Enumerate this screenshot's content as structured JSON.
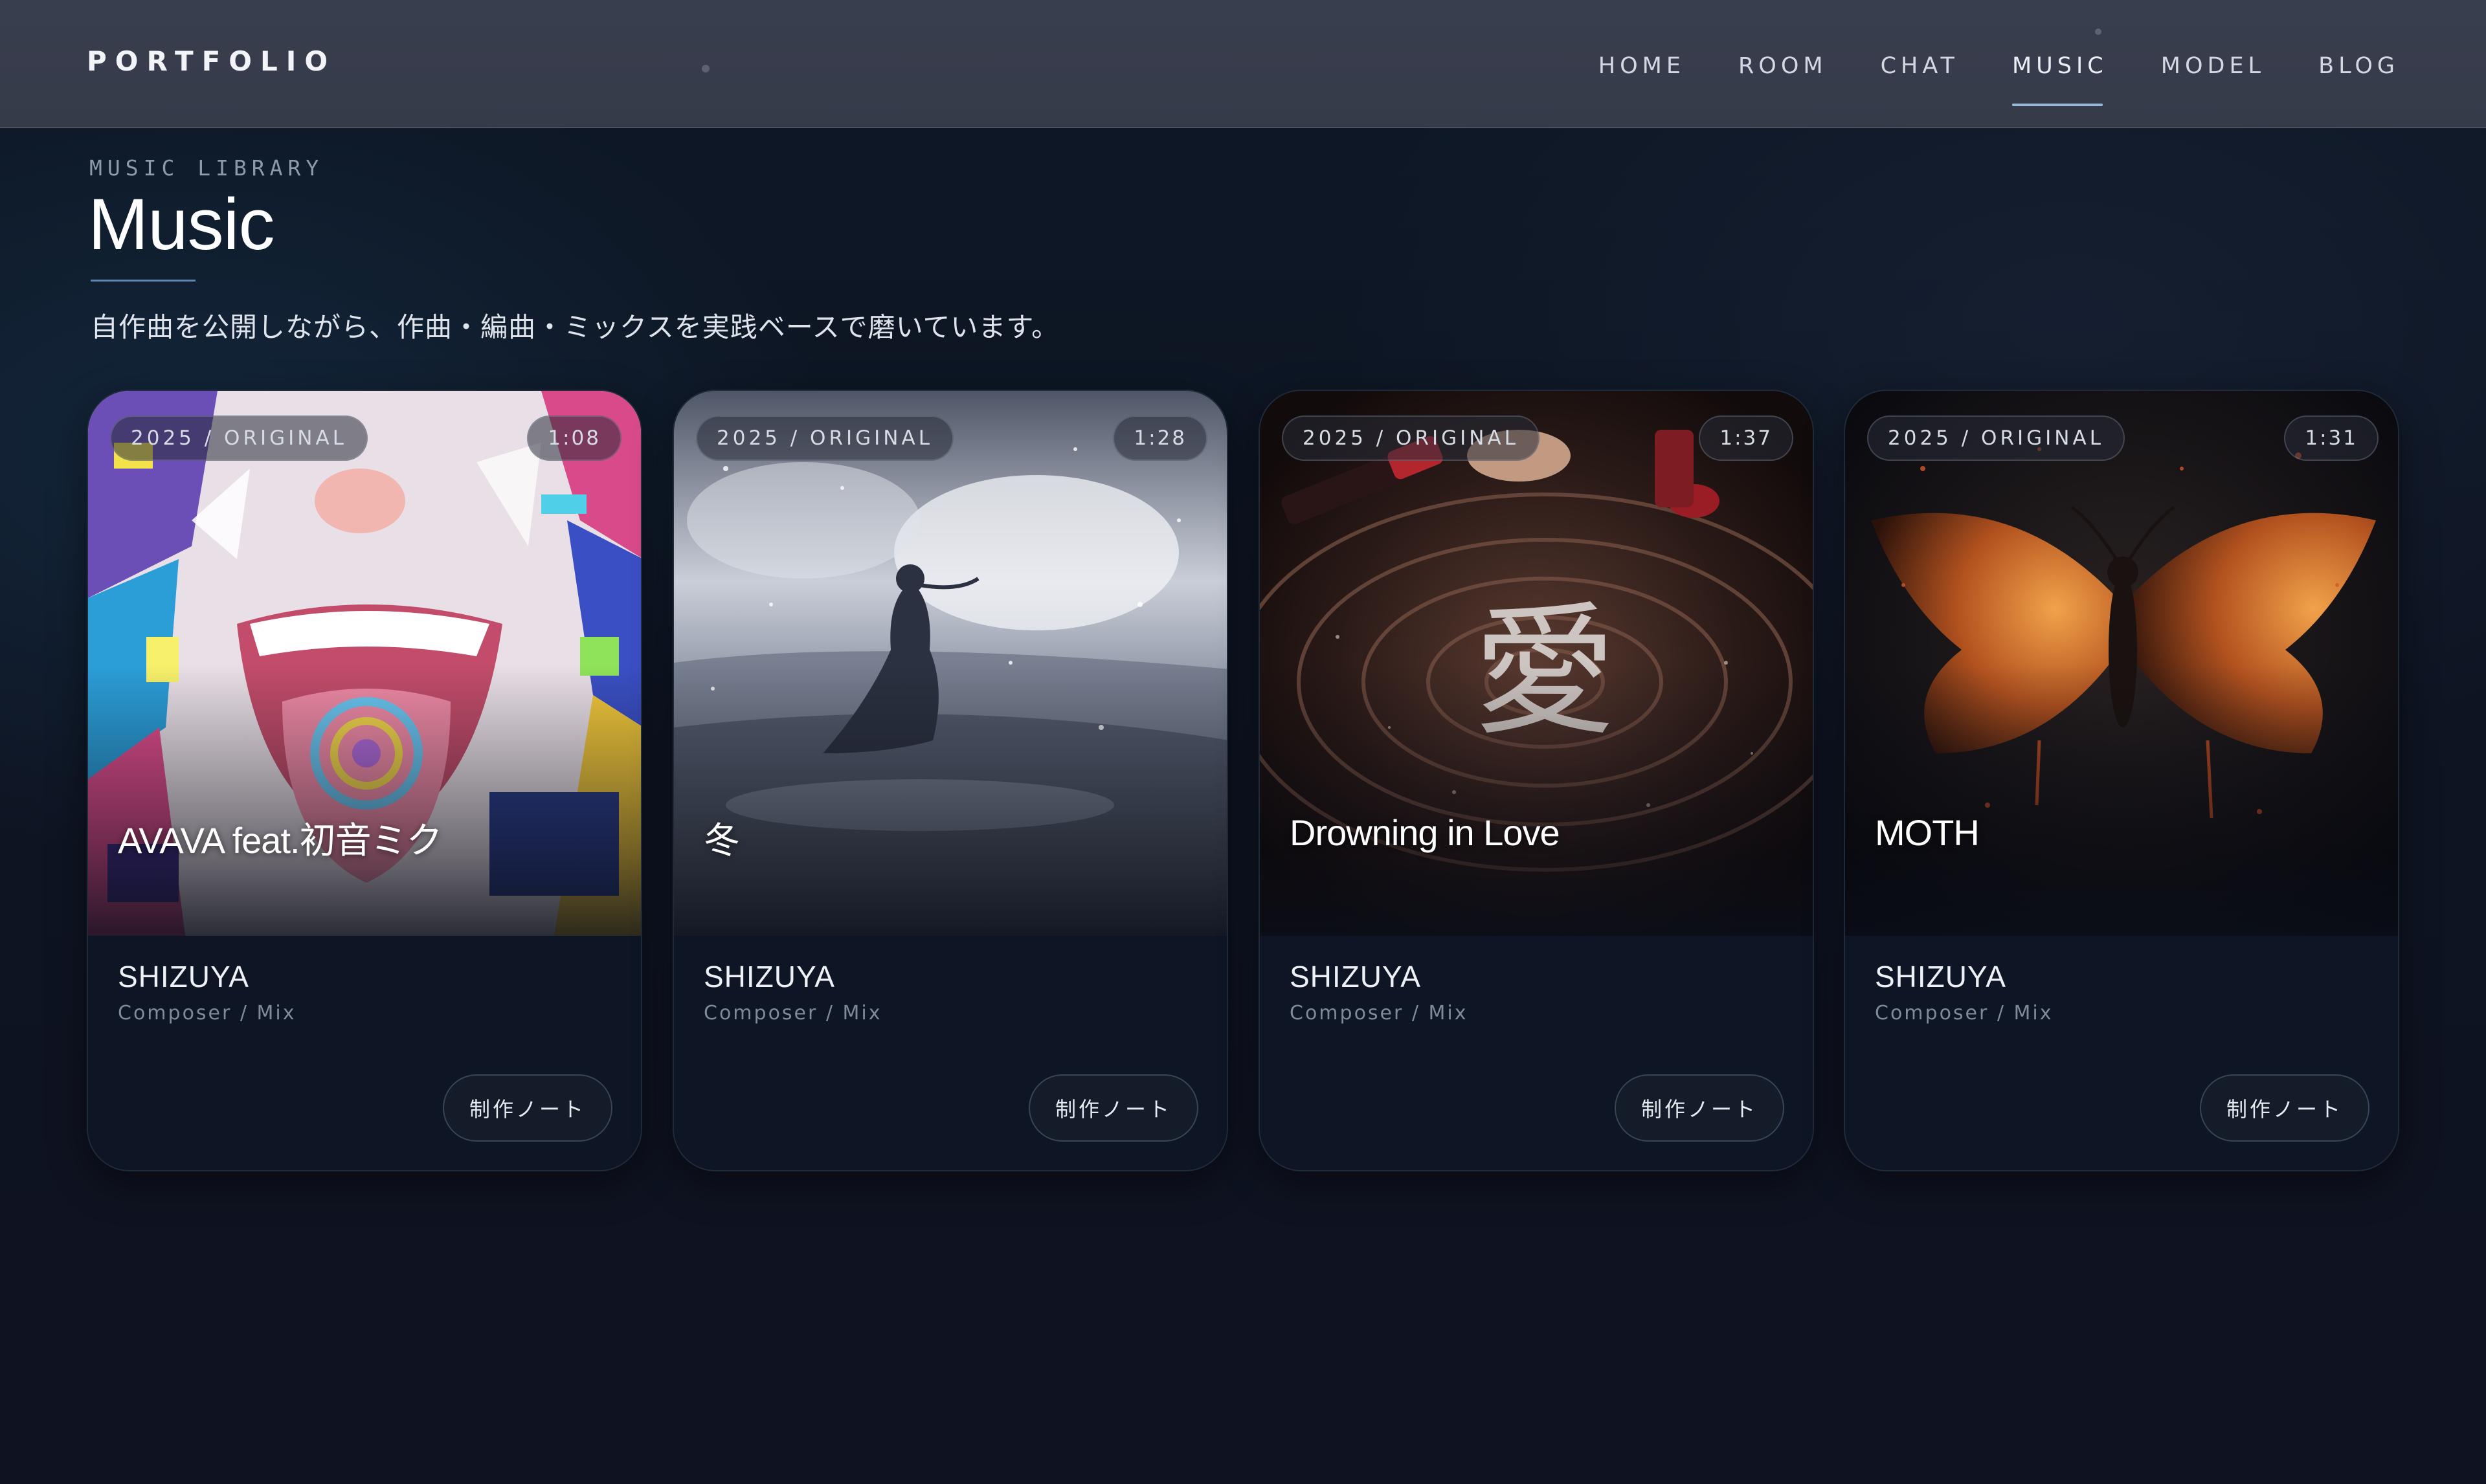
{
  "header": {
    "brand": "PORTFOLIO",
    "nav": [
      {
        "label": "HOME",
        "active": false
      },
      {
        "label": "ROOM",
        "active": false
      },
      {
        "label": "CHAT",
        "active": false
      },
      {
        "label": "MUSIC",
        "active": true
      },
      {
        "label": "MODEL",
        "active": false
      },
      {
        "label": "BLOG",
        "active": false
      }
    ]
  },
  "hero": {
    "eyebrow": "MUSIC LIBRARY",
    "title": "Music",
    "lead": "自作曲を公開しながら、作曲・編曲・ミックスを実践ベースで磨いています。"
  },
  "cards": [
    {
      "meta": "2025 / ORIGINAL",
      "duration": "1:08",
      "title": "AVAVA feat.初音ミク",
      "artist": "SHIZUYA",
      "role": "Composer / Mix",
      "button": "制作ノート",
      "art": "anime-mouth-illustration"
    },
    {
      "meta": "2025 / ORIGINAL",
      "duration": "1:28",
      "title": "冬",
      "artist": "SHIZUYA",
      "role": "Composer / Mix",
      "button": "制作ノート",
      "art": "winter-figure-snowscape"
    },
    {
      "meta": "2025 / ORIGINAL",
      "duration": "1:37",
      "title": "Drowning in Love",
      "artist": "SHIZUYA",
      "role": "Composer / Mix",
      "button": "制作ノート",
      "art": "love-kanji-water-ripples"
    },
    {
      "meta": "2025 / ORIGINAL",
      "duration": "1:31",
      "title": "MOTH",
      "artist": "SHIZUYA",
      "role": "Composer / Mix",
      "button": "制作ノート",
      "art": "moth-wings-sparks"
    }
  ],
  "colors": {
    "header_bg": "#393e4e",
    "page_bg": "#0e1421",
    "accent_underline": "#9ab8d8",
    "card_bg": "#0e1524"
  }
}
